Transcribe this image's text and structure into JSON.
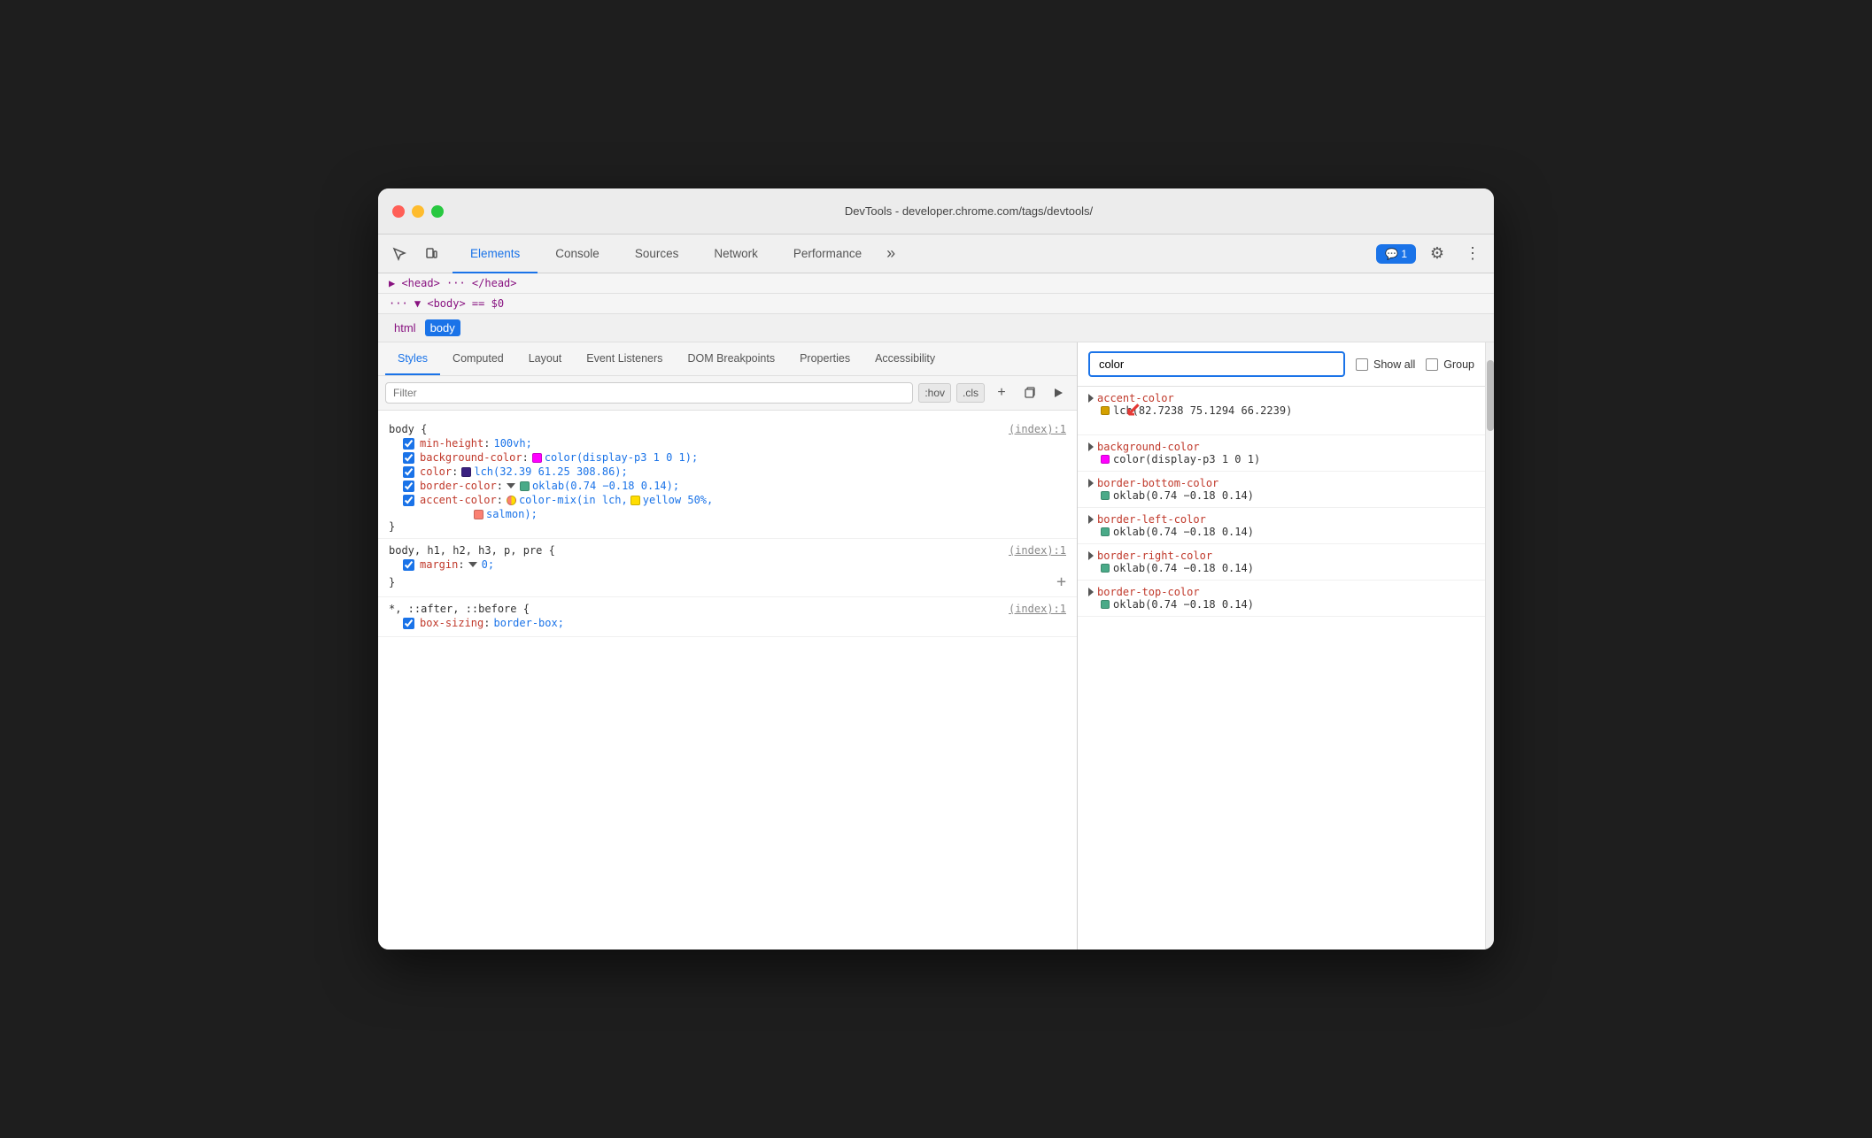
{
  "window": {
    "title": "DevTools - developer.chrome.com/tags/devtools/"
  },
  "toolbar": {
    "tabs": [
      {
        "id": "elements",
        "label": "Elements",
        "active": true
      },
      {
        "id": "console",
        "label": "Console",
        "active": false
      },
      {
        "id": "sources",
        "label": "Sources",
        "active": false
      },
      {
        "id": "network",
        "label": "Network",
        "active": false
      },
      {
        "id": "performance",
        "label": "Performance",
        "active": false
      }
    ],
    "more_label": "»",
    "badge_label": "💬 1",
    "settings_label": "⚙",
    "menu_label": "⋮"
  },
  "dom": {
    "head_text": "▶ <head> ··· </head>",
    "body_text": "··· ▼ <body> == $0"
  },
  "breadcrumb": {
    "tags": [
      {
        "id": "html",
        "label": "html",
        "active": false
      },
      {
        "id": "body",
        "label": "body",
        "active": true
      }
    ]
  },
  "styles_tabs": [
    {
      "id": "styles",
      "label": "Styles",
      "active": true
    },
    {
      "id": "computed",
      "label": "Computed",
      "active": false
    },
    {
      "id": "layout",
      "label": "Layout",
      "active": false
    },
    {
      "id": "event-listeners",
      "label": "Event Listeners",
      "active": false
    },
    {
      "id": "dom-breakpoints",
      "label": "DOM Breakpoints",
      "active": false
    },
    {
      "id": "properties",
      "label": "Properties",
      "active": false
    },
    {
      "id": "accessibility",
      "label": "Accessibility",
      "active": false
    }
  ],
  "filter": {
    "placeholder": "Filter",
    "hov_label": ":hov",
    "cls_label": ".cls"
  },
  "css_rules": [
    {
      "id": "rule-body",
      "selector": "body {",
      "source": "(index):1",
      "properties": [
        {
          "id": "min-height",
          "name": "min-height",
          "value": "100vh;",
          "swatch": null,
          "checked": true
        },
        {
          "id": "background-color",
          "name": "background-color",
          "value": "color(display-p3 1 0 1);",
          "swatch": "#ff00ff",
          "checked": true
        },
        {
          "id": "color",
          "name": "color",
          "value": "lch(32.39 61.25 308.86);",
          "swatch": "#3a2080",
          "checked": true
        },
        {
          "id": "border-color",
          "name": "border-color",
          "value": "oklab(0.74 −0.18 0.14);",
          "swatch": "#4a9",
          "has_triangle": true,
          "checked": true
        },
        {
          "id": "accent-color",
          "name": "accent-color",
          "value": "color-mix(in lch,",
          "swatch": "mixed",
          "value2": "yellow 50%,",
          "swatch2": "#ffdd00",
          "value3": "salmon);",
          "swatch3": "#fa8072",
          "checked": true
        }
      ],
      "close": "}"
    },
    {
      "id": "rule-body-headings",
      "selector": "body, h1, h2, h3, p, pre {",
      "source": "(index):1",
      "properties": [
        {
          "id": "margin",
          "name": "margin",
          "value": "0;",
          "swatch": null,
          "has_triangle": true,
          "checked": true
        }
      ],
      "close": "}"
    },
    {
      "id": "rule-universal",
      "selector": "*, ::after, ::before {",
      "source": "(index):1",
      "properties": [
        {
          "id": "box-sizing",
          "name": "box-sizing",
          "value": "border-box;",
          "swatch": null,
          "checked": true
        }
      ],
      "close": ""
    }
  ],
  "computed_panel": {
    "search_value": "color",
    "show_all_label": "Show all",
    "group_label": "Group",
    "items": [
      {
        "id": "accent-color",
        "prop": "accent-color",
        "swatch": "#d4a000",
        "value": "lch(82.7238 75.1294 66.2239)"
      },
      {
        "id": "background-color",
        "prop": "background-color",
        "swatch": "#ff00ff",
        "value": "color(display-p3 1 0 1)"
      },
      {
        "id": "border-bottom-color",
        "prop": "border-bottom-color",
        "swatch": "#4a9",
        "value": "oklab(0.74 −0.18 0.14)"
      },
      {
        "id": "border-left-color",
        "prop": "border-left-color",
        "swatch": "#4a9",
        "value": "oklab(0.74 −0.18 0.14)"
      },
      {
        "id": "border-right-color",
        "prop": "border-right-color",
        "swatch": "#4a9",
        "value": "oklab(0.74 −0.18 0.14)"
      },
      {
        "id": "border-top-color",
        "prop": "border-top-color",
        "swatch": "#4a9",
        "value": "oklab(0.74 −0.18 0.14)"
      }
    ]
  }
}
